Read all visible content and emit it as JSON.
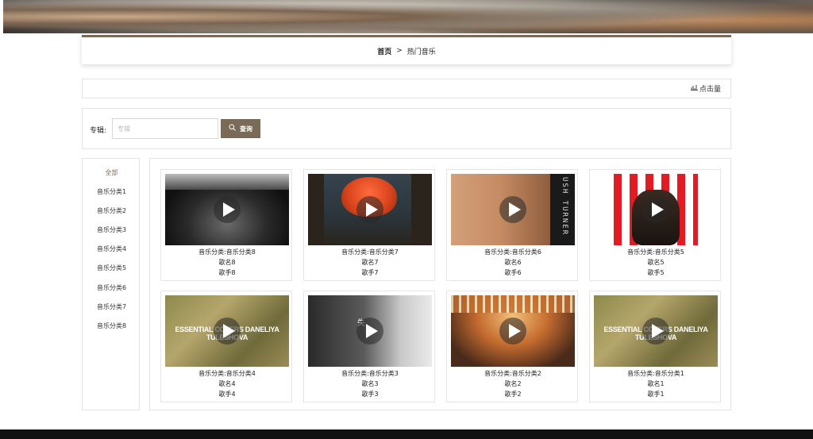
{
  "breadcrumb": {
    "home": "首页",
    "separator": ">",
    "current": "热门音乐"
  },
  "sort": {
    "label": "点击量"
  },
  "search": {
    "label": "专辑:",
    "placeholder": "专辑",
    "button_label": "查询"
  },
  "categories": [
    {
      "label": "全部",
      "active": true
    },
    {
      "label": "音乐分类1"
    },
    {
      "label": "音乐分类2"
    },
    {
      "label": "音乐分类3"
    },
    {
      "label": "音乐分类4"
    },
    {
      "label": "音乐分类5"
    },
    {
      "label": "音乐分类6"
    },
    {
      "label": "音乐分类7"
    },
    {
      "label": "音乐分类8"
    }
  ],
  "songs": [
    {
      "category": "音乐分类:音乐分类8",
      "name": "歌名8",
      "singer": "歌手8"
    },
    {
      "category": "音乐分类:音乐分类7",
      "name": "歌名7",
      "singer": "歌手7"
    },
    {
      "category": "音乐分类:音乐分类6",
      "name": "歌名6",
      "singer": "歌手6",
      "cover_text": "USH TURNER"
    },
    {
      "category": "音乐分类:音乐分类5",
      "name": "歌名5",
      "singer": "歌手5"
    },
    {
      "category": "音乐分类:音乐分类4",
      "name": "歌名4",
      "singer": "歌手4",
      "cover_text": "ESSENTIAL COVERS DANELIYA TULESHOVA"
    },
    {
      "category": "音乐分类:音乐分类3",
      "name": "歌名3",
      "singer": "歌手3",
      "cover_text": "失"
    },
    {
      "category": "音乐分类:音乐分类2",
      "name": "歌名2",
      "singer": "歌手2"
    },
    {
      "category": "音乐分类:音乐分类1",
      "name": "歌名1",
      "singer": "歌手1",
      "cover_text": "ESSENTIAL COVERS DANELIYA TULESHOVA"
    }
  ],
  "colors": {
    "accent": "#7a6a58",
    "border": "#e2e2e2",
    "footer": "#111111"
  }
}
